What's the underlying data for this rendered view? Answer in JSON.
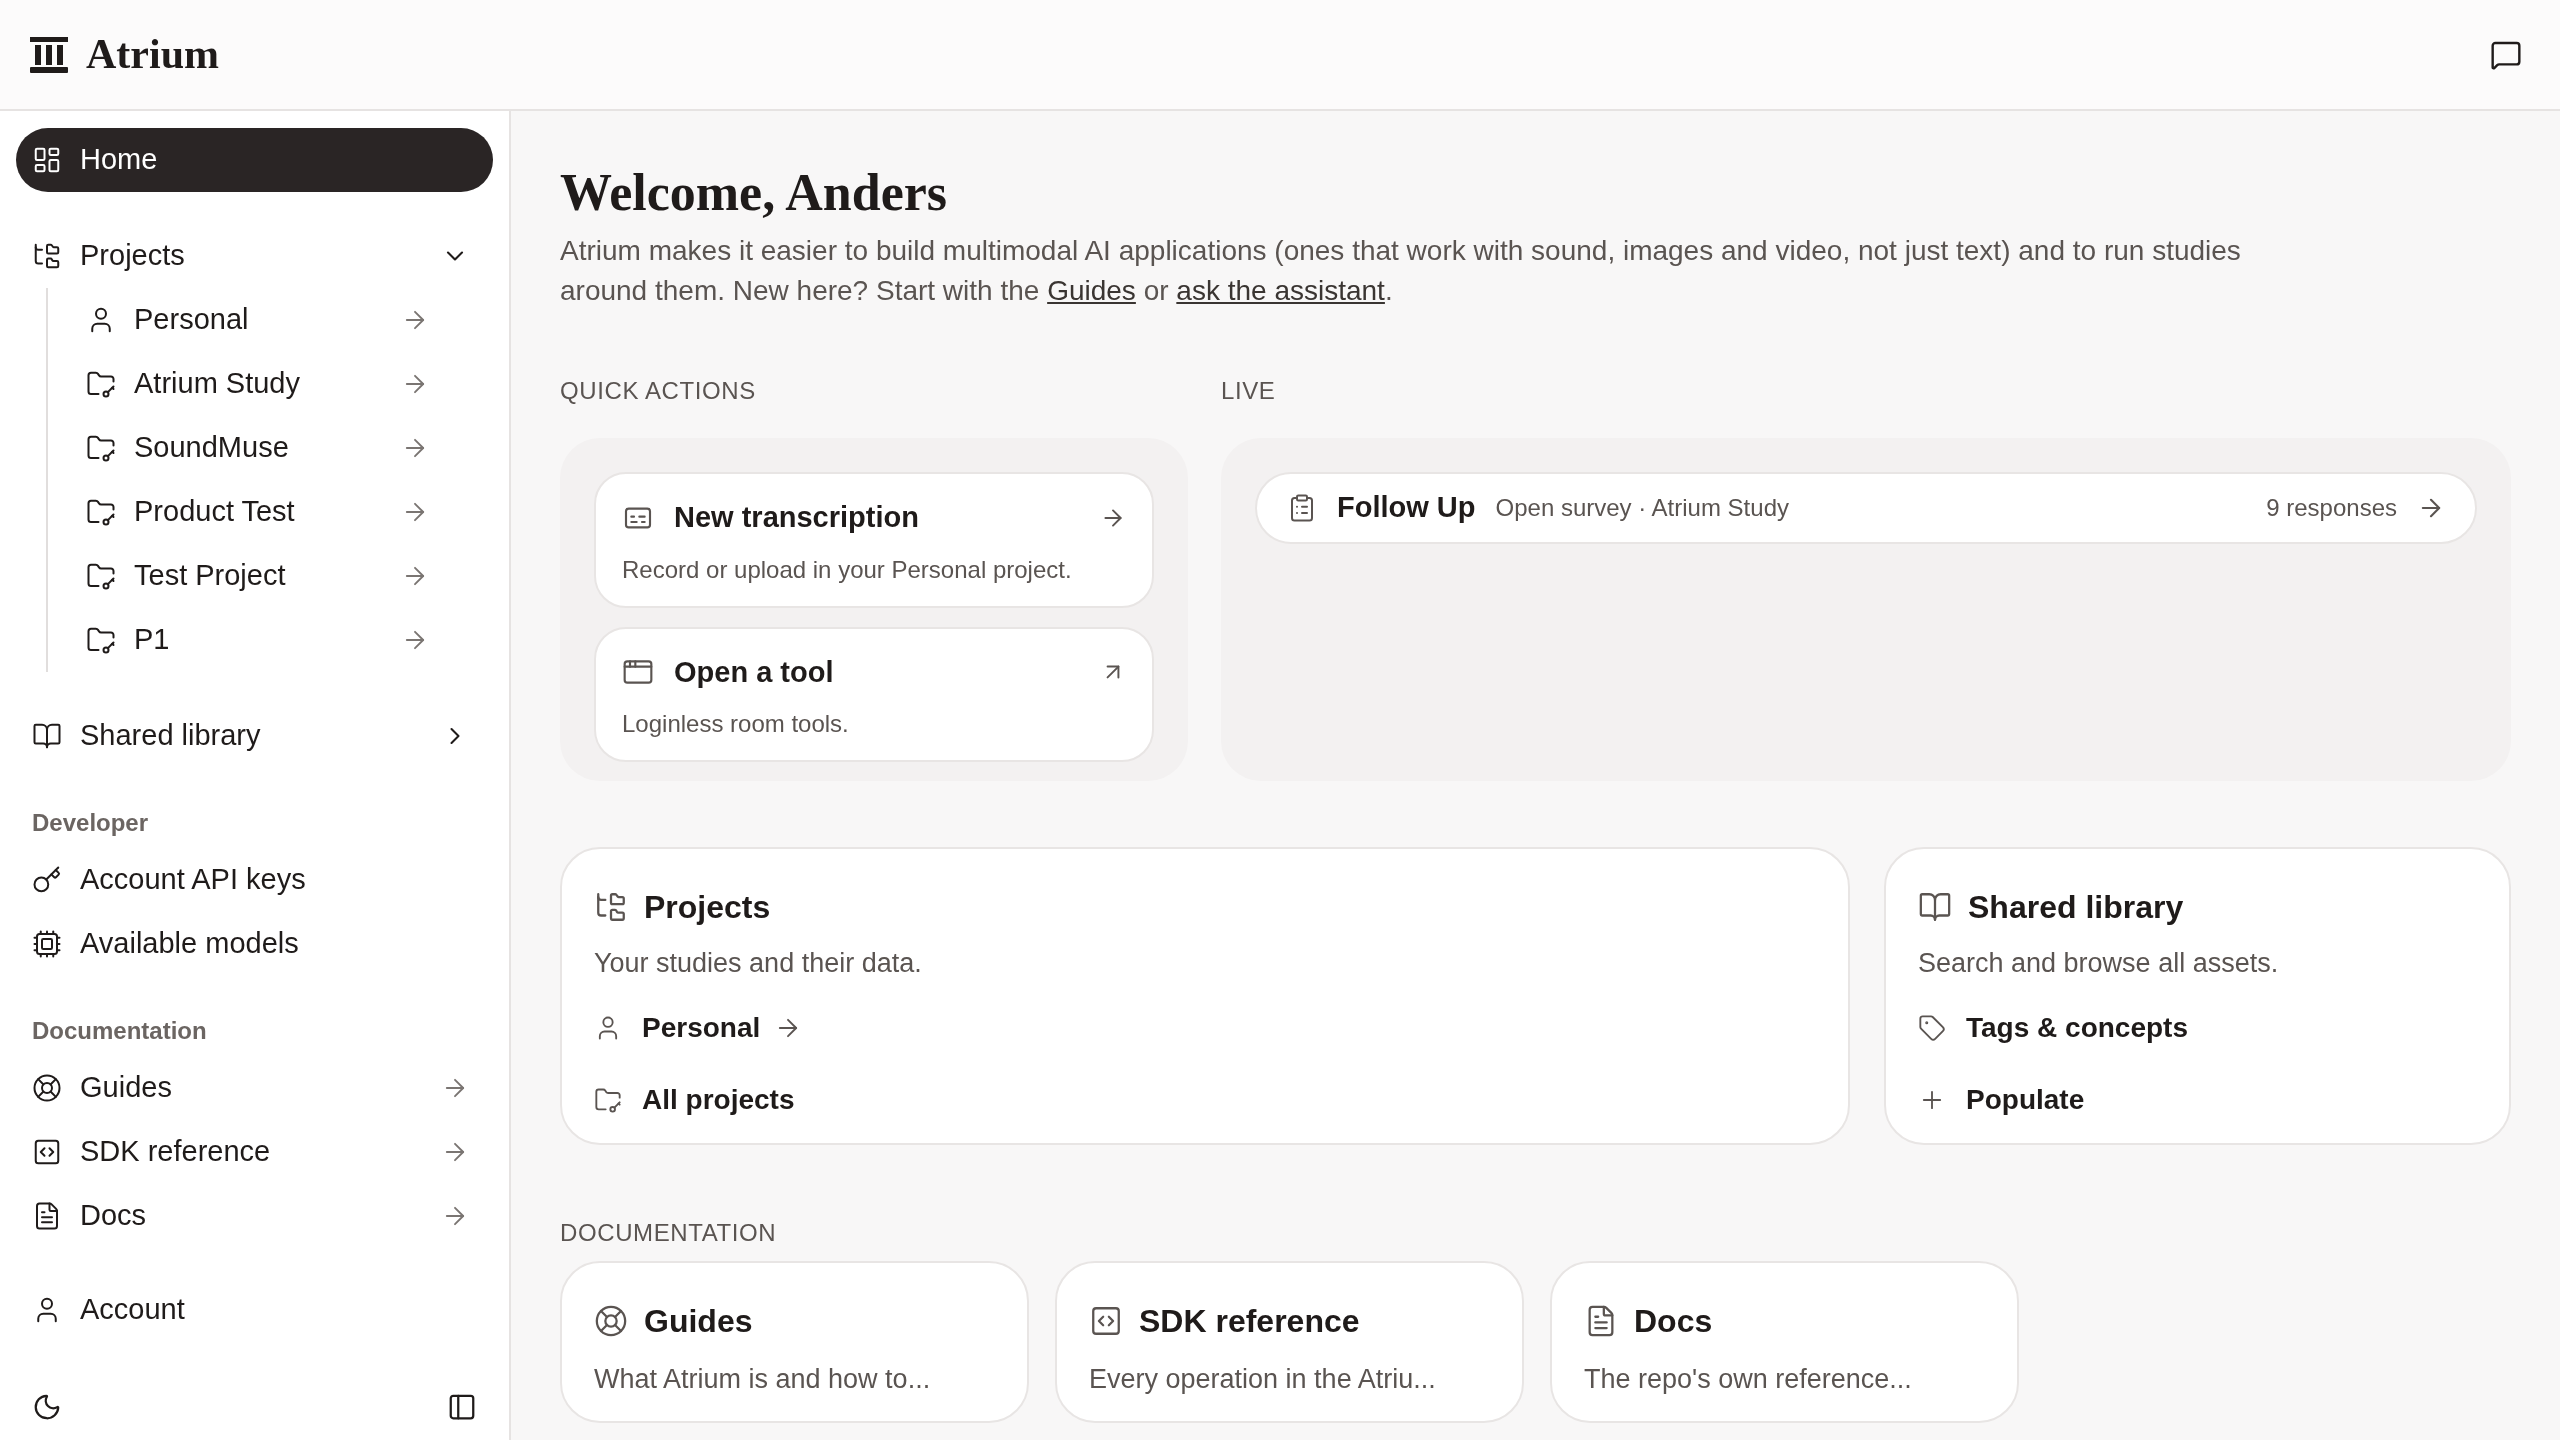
{
  "header": {
    "brand": "Atrium"
  },
  "sidebar": {
    "home": {
      "label": "Home",
      "selected": true
    },
    "projects": {
      "label": "Projects",
      "expanded": true,
      "selected": false,
      "children": [
        {
          "label": "Personal",
          "kind": "personal",
          "selected": false
        },
        {
          "label": "Atrium Study",
          "kind": "project",
          "selected": false
        },
        {
          "label": "SoundMuse",
          "kind": "project",
          "selected": false
        },
        {
          "label": "Product Test",
          "kind": "project",
          "selected": false
        },
        {
          "label": "Test Project",
          "kind": "project",
          "selected": false
        },
        {
          "label": "P1",
          "kind": "project",
          "selected": false
        }
      ]
    },
    "shared_library": {
      "label": "Shared library",
      "expanded": false,
      "selected": false
    },
    "sections": [
      {
        "title": "Developer",
        "items": [
          {
            "label": "Account API keys",
            "kind": "page",
            "selected": false
          },
          {
            "label": "Available models",
            "kind": "page",
            "selected": false
          }
        ]
      },
      {
        "title": "Documentation",
        "items": [
          {
            "label": "Guides",
            "kind": "link",
            "selected": false
          },
          {
            "label": "SDK reference",
            "kind": "link",
            "selected": false
          },
          {
            "label": "Docs",
            "kind": "link",
            "selected": false
          }
        ]
      }
    ],
    "account": {
      "label": "Account",
      "selected": false
    }
  },
  "main": {
    "title": "Welcome, Anders",
    "intro": [
      {
        "kind": "text",
        "text": "Atrium makes it easier to build multimodal AI applications (ones that work with sound, images and video, not just text) and to run studies around them. New here? Start with the "
      },
      {
        "kind": "link",
        "text": "Guides"
      },
      {
        "kind": "text",
        "text": " or "
      },
      {
        "kind": "link",
        "text": "ask the assistant"
      },
      {
        "kind": "text",
        "text": "."
      }
    ],
    "quick_actions": {
      "title": "QUICK ACTIONS",
      "items": [
        {
          "title": "New transcription",
          "description": "Record or upload in your Personal project.",
          "kind": "internal"
        },
        {
          "title": "Open a tool",
          "description": "Loginless room tools.",
          "kind": "external"
        }
      ]
    },
    "live": {
      "title": "LIVE",
      "items": [
        {
          "title": "Follow Up",
          "meta": "Open survey · Atrium Study",
          "count": "9 responses"
        }
      ]
    },
    "cards": [
      {
        "title": "Projects",
        "description": "Your studies and their data.",
        "links": [
          {
            "label": "Personal",
            "kind": "arrow"
          },
          {
            "label": "All projects",
            "kind": "plain"
          }
        ]
      },
      {
        "title": "Shared library",
        "description": "Search and browse all assets.",
        "links": [
          {
            "label": "Tags & concepts",
            "kind": "plain"
          },
          {
            "label": "Populate",
            "kind": "plain"
          }
        ]
      }
    ],
    "documentation": {
      "title": "DOCUMENTATION",
      "items": [
        {
          "title": "Guides",
          "description": "What Atrium is and how to..."
        },
        {
          "title": "SDK reference",
          "description": "Every operation in the Atriu..."
        },
        {
          "title": "Docs",
          "description": "The repo's own reference..."
        }
      ]
    }
  }
}
